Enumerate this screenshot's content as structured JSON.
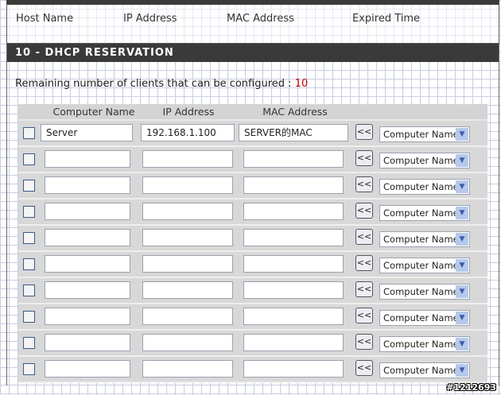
{
  "client_list": {
    "columns": [
      "Host Name",
      "IP Address",
      "MAC Address",
      "Expired Time"
    ]
  },
  "reservation": {
    "title": "10 - DHCP RESERVATION",
    "remaining_label": "Remaining number of clients that can be configured : ",
    "remaining_count": "10",
    "columns": [
      "Computer Name",
      "IP Address",
      "MAC Address"
    ],
    "copy_button": "<<",
    "rows": [
      {
        "name": "Server",
        "ip": "192.168.1.100",
        "mac": "SERVER的MAC",
        "select": "Computer Name"
      },
      {
        "name": "",
        "ip": "",
        "mac": "",
        "select": "Computer Name"
      },
      {
        "name": "",
        "ip": "",
        "mac": "",
        "select": "Computer Name"
      },
      {
        "name": "",
        "ip": "",
        "mac": "",
        "select": "Computer Name"
      },
      {
        "name": "",
        "ip": "",
        "mac": "",
        "select": "Computer Name"
      },
      {
        "name": "",
        "ip": "",
        "mac": "",
        "select": "Computer Name"
      },
      {
        "name": "",
        "ip": "",
        "mac": "",
        "select": "Computer Name"
      },
      {
        "name": "",
        "ip": "",
        "mac": "",
        "select": "Computer Name"
      },
      {
        "name": "",
        "ip": "",
        "mac": "",
        "select": "Computer Name"
      },
      {
        "name": "",
        "ip": "",
        "mac": "",
        "select": "Computer Name"
      }
    ]
  },
  "watermark": "#1212693"
}
